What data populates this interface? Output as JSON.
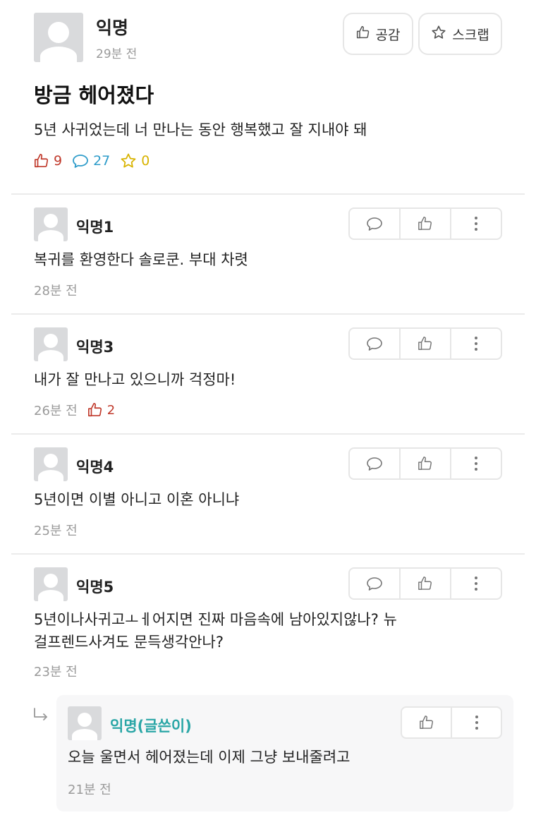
{
  "post": {
    "author": "익명",
    "time": "29분 전",
    "like_button": "공감",
    "scrap_button": "스크랩",
    "title": "방금 헤어졌다",
    "body": "5년 사귀었는데 너 만나는 동안 행복했고 잘 지내야 돼",
    "stats": {
      "likes": "9",
      "comments": "27",
      "scraps": "0"
    }
  },
  "comments": [
    {
      "author": "익명1",
      "text": "복귀를 환영한다 솔로쿤. 부대 차렷",
      "time": "28분 전"
    },
    {
      "author": "익명3",
      "text": "내가 잘 만나고 있으니까 걱정마!",
      "time": "26분 전",
      "likes": "2"
    },
    {
      "author": "익명4",
      "text": "5년이면 이별 아니고 이혼 아니냐",
      "time": "25분 전"
    },
    {
      "author": "익명5",
      "text_line1": "5년이나사귀고ㅗㅔ어지면 진짜 마음속에 남아있지않나? 뉴",
      "text_line2": "걸프렌드사겨도 문득생각안나?",
      "time": "23분 전"
    }
  ],
  "reply": {
    "author": "익명(글쓴이)",
    "text": "오늘 울면서 헤어졌는데 이제 그냥 보내줄려고",
    "time": "21분 전"
  },
  "colors": {
    "like": "#c0392b",
    "comment": "#2e9cca",
    "scrap": "#d8b300",
    "writer": "#2aa6a6"
  }
}
